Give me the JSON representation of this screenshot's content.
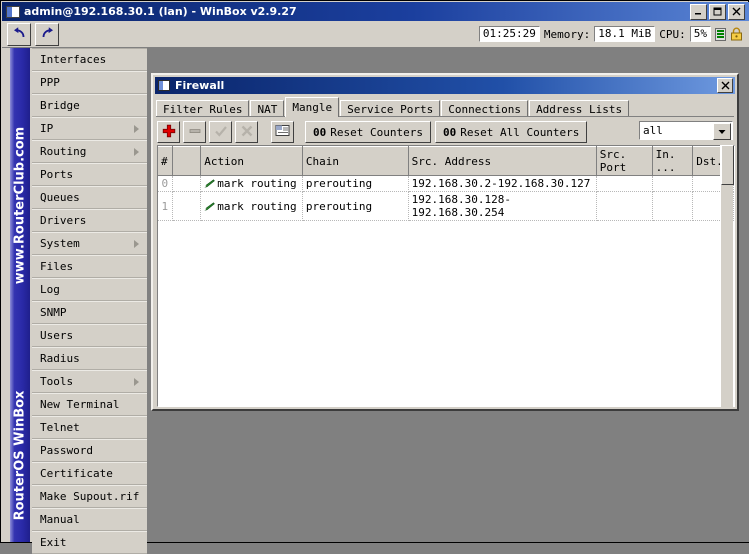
{
  "window": {
    "title": "admin@192.168.30.1 (lan) - WinBox v2.9.27",
    "minimize": "_",
    "maximize": "□",
    "close": "✕"
  },
  "toolbar": {
    "undo_icon": "undo-arrow",
    "redo_icon": "redo-arrow"
  },
  "status": {
    "time": "01:25:29",
    "memory_label": "Memory:",
    "memory_value": "18.1 MiB",
    "cpu_label": "CPU:",
    "cpu_value": "5%",
    "signal_icon": "signal-bars-icon",
    "lock_icon": "padlock-icon"
  },
  "sidebar": {
    "watermark_top": "www.RouterClub.com",
    "watermark_bottom": "RouterOS WinBox",
    "items": [
      {
        "label": "Interfaces",
        "submenu": false
      },
      {
        "label": "PPP",
        "submenu": false
      },
      {
        "label": "Bridge",
        "submenu": false
      },
      {
        "label": "IP",
        "submenu": true
      },
      {
        "label": "Routing",
        "submenu": true
      },
      {
        "label": "Ports",
        "submenu": false
      },
      {
        "label": "Queues",
        "submenu": false
      },
      {
        "label": "Drivers",
        "submenu": false
      },
      {
        "label": "System",
        "submenu": true
      },
      {
        "label": "Files",
        "submenu": false
      },
      {
        "label": "Log",
        "submenu": false
      },
      {
        "label": "SNMP",
        "submenu": false
      },
      {
        "label": "Users",
        "submenu": false
      },
      {
        "label": "Radius",
        "submenu": false
      },
      {
        "label": "Tools",
        "submenu": true
      },
      {
        "label": "New Terminal",
        "submenu": false
      },
      {
        "label": "Telnet",
        "submenu": false
      },
      {
        "label": "Password",
        "submenu": false
      },
      {
        "label": "Certificate",
        "submenu": false
      },
      {
        "label": "Make Supout.rif",
        "submenu": false
      },
      {
        "label": "Manual",
        "submenu": false
      },
      {
        "label": "Exit",
        "submenu": false
      }
    ]
  },
  "firewall": {
    "title": "Firewall",
    "close": "✕",
    "tabs": [
      {
        "label": "Filter Rules",
        "active": false
      },
      {
        "label": "NAT",
        "active": false
      },
      {
        "label": "Mangle",
        "active": true
      },
      {
        "label": "Service Ports",
        "active": false
      },
      {
        "label": "Connections",
        "active": false
      },
      {
        "label": "Address Lists",
        "active": false
      }
    ],
    "actions": {
      "add_icon": "plus-icon",
      "remove_icon": "minus-icon",
      "enable_icon": "check-icon",
      "disable_icon": "cross-icon",
      "comment_icon": "comment-box-icon",
      "reset_counters_count": "00",
      "reset_counters_label": "Reset Counters",
      "reset_all_counters_count": "00",
      "reset_all_counters_label": "Reset All Counters",
      "filter_value": "all",
      "filter_arrow_icon": "chevron-down-icon"
    },
    "columns": [
      "#",
      "",
      "Action",
      "Chain",
      "Src. Address",
      "Src. Port",
      "In. ...",
      "Dst."
    ],
    "rows": [
      {
        "num": "0",
        "action_icon": "pencil-icon",
        "action": "mark routing",
        "chain": "prerouting",
        "src_address": "192.168.30.2-192.168.30.127",
        "src_port": "",
        "in_iface": "",
        "dst": ""
      },
      {
        "num": "1",
        "action_icon": "pencil-icon",
        "action": "mark routing",
        "chain": "prerouting",
        "src_address": "192.168.30.128-192.168.30.254",
        "src_port": "",
        "in_iface": "",
        "dst": ""
      }
    ]
  },
  "colors": {
    "titlebar_blue": "#0a246a",
    "face": "#d4d0c8",
    "desktop": "#808080",
    "accent_red": "#e00000",
    "accent_green": "#2e8b2e",
    "strip_blue": "#2a2aa8"
  }
}
